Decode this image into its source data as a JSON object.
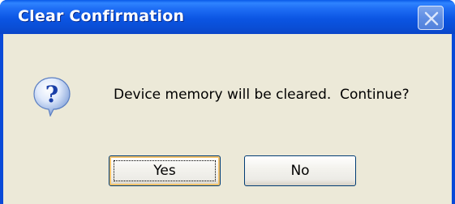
{
  "window": {
    "title": "Clear Confirmation",
    "close_icon": "close-icon"
  },
  "dialog": {
    "icon": "question-icon",
    "message": "Device memory will be cleared.  Continue?"
  },
  "buttons": {
    "yes_label": "Yes",
    "no_label": "No"
  },
  "colors": {
    "titlebar": "#0a4ed6",
    "client_background": "#ece9d8",
    "button_border": "#003c74",
    "default_button_highlight": "#f4c26b"
  }
}
